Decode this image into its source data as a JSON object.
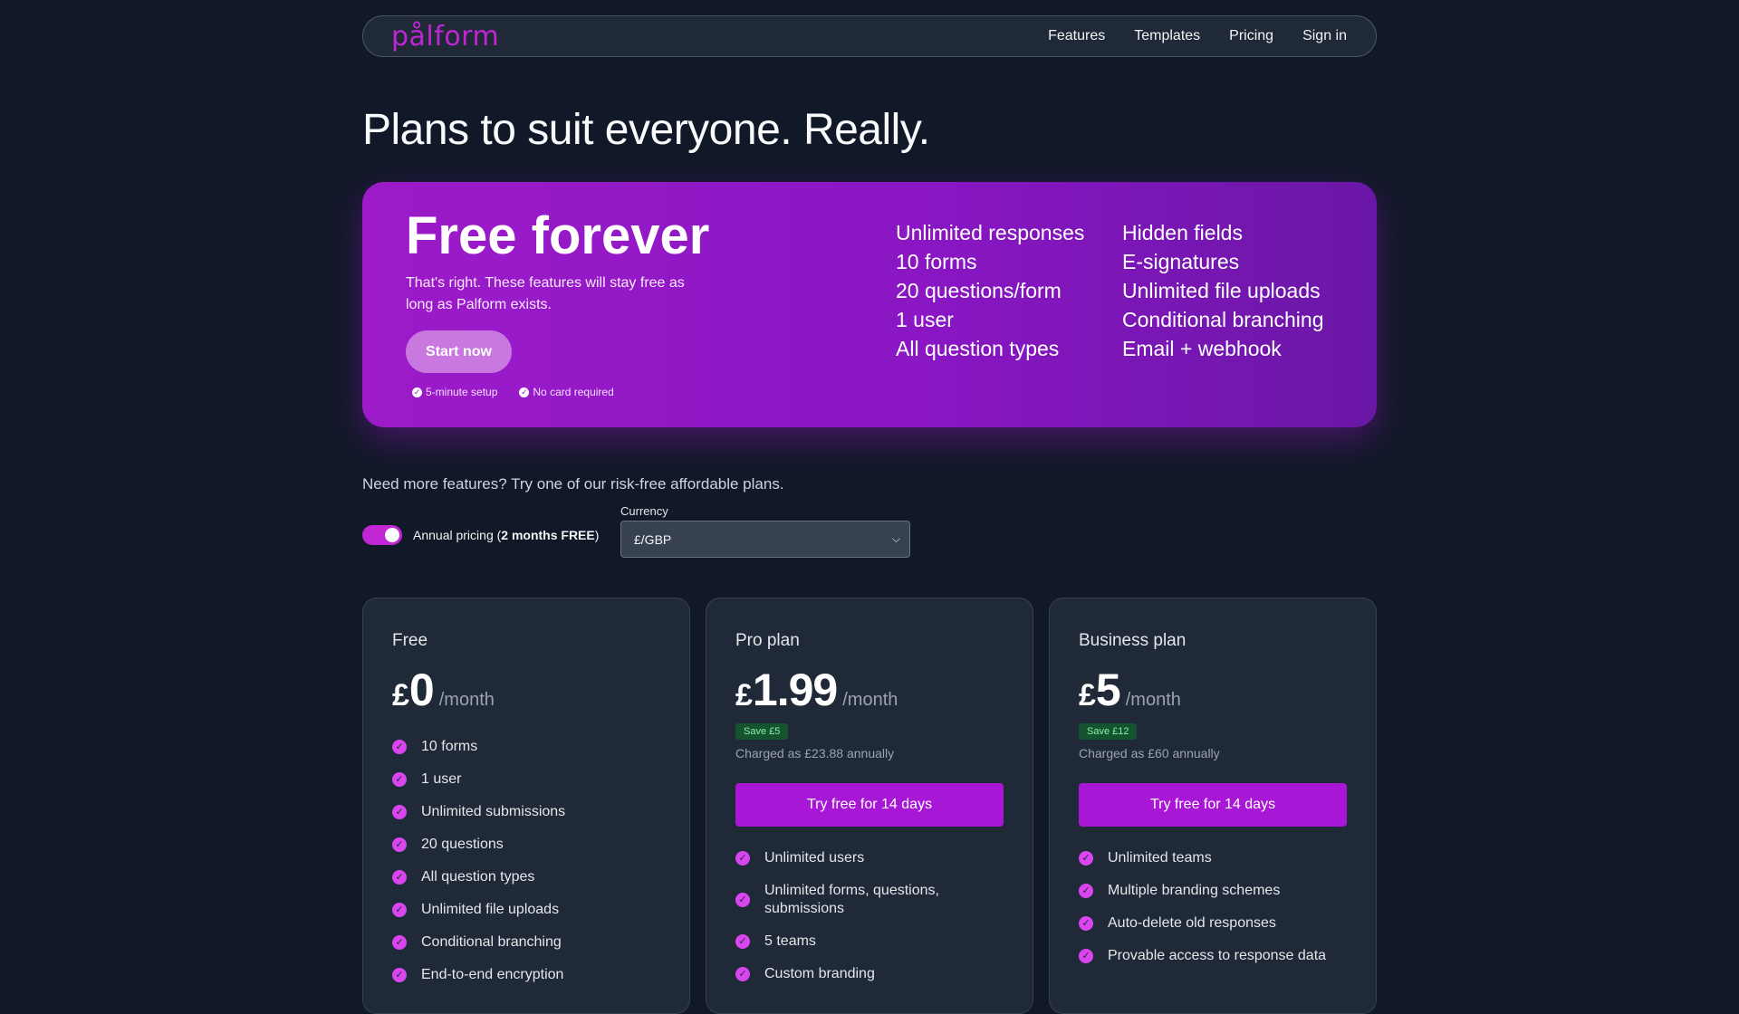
{
  "nav": {
    "logo": "pålform",
    "links": [
      "Features",
      "Templates",
      "Pricing",
      "Sign in"
    ]
  },
  "page_title": "Plans to suit everyone. Really.",
  "hero": {
    "title": "Free forever",
    "subtitle": "That's right. These features will stay free as long as Palform exists.",
    "cta": "Start now",
    "checks": [
      "5-minute setup",
      "No card required"
    ],
    "features_col1": [
      "Unlimited responses",
      "10 forms",
      "20 questions/form",
      "1 user",
      "All question types"
    ],
    "features_col2": [
      "Hidden fields",
      "E-signatures",
      "Unlimited file uploads",
      "Conditional branching",
      "Email + webhook"
    ]
  },
  "more_text": "Need more features? Try one of our risk-free affordable plans.",
  "controls": {
    "toggle_on": true,
    "toggle_label_prefix": "Annual pricing (",
    "toggle_label_bold": "2 months FREE",
    "toggle_label_suffix": ")",
    "currency_label": "Currency",
    "currency_value": "£/GBP"
  },
  "plans": [
    {
      "name": "Free",
      "currency": "£",
      "amount": "0",
      "period": "/month",
      "features": [
        "10 forms",
        "1 user",
        "Unlimited submissions",
        "20 questions",
        "All question types",
        "Unlimited file uploads",
        "Conditional branching",
        "End-to-end encryption"
      ]
    },
    {
      "name": "Pro plan",
      "currency": "£",
      "amount": "1.99",
      "period": "/month",
      "save": "Save £5",
      "charged": "Charged as £23.88 annually",
      "cta": "Try free for 14 days",
      "features": [
        "Unlimited users",
        "Unlimited forms, questions, submissions",
        "5 teams",
        "Custom branding"
      ]
    },
    {
      "name": "Business plan",
      "currency": "£",
      "amount": "5",
      "period": "/month",
      "save": "Save £12",
      "charged": "Charged as £60 annually",
      "cta": "Try free for 14 days",
      "features": [
        "Unlimited teams",
        "Multiple branding schemes",
        "Auto-delete old responses",
        "Provable access to response data"
      ]
    }
  ],
  "colors": {
    "background": "#111827",
    "accent": "#a817d6",
    "check": "#d946ef",
    "save_badge_bg": "#14532d"
  }
}
